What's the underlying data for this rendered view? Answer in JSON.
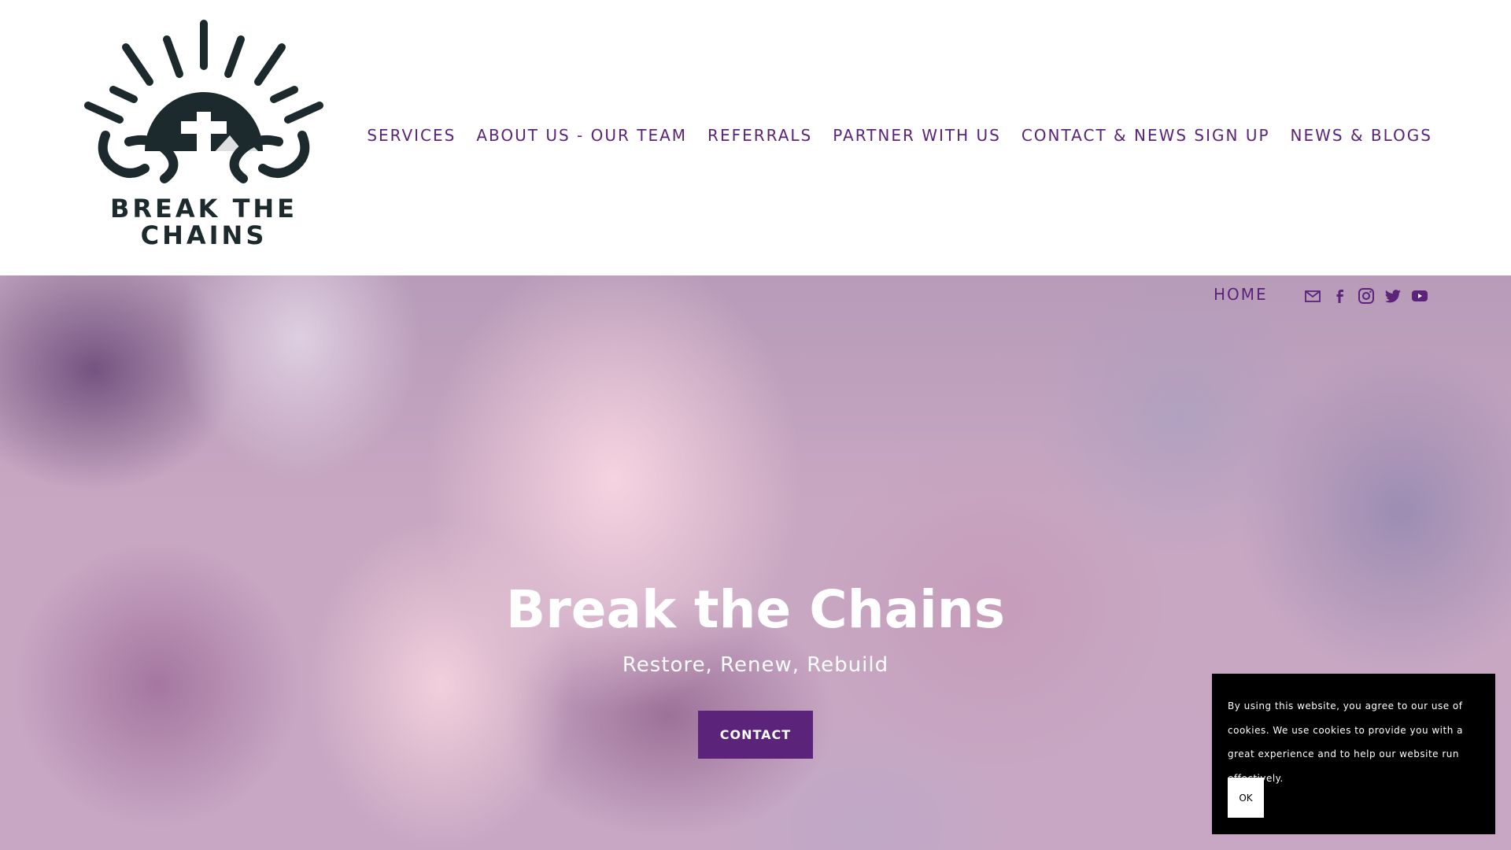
{
  "colors": {
    "brand_purple": "#5b237a",
    "logo_dark": "#1c2a2e",
    "cookie_bg": "#000000"
  },
  "logo": {
    "line1": "BREAK THE",
    "line2": "CHAINS"
  },
  "nav": {
    "items": [
      {
        "label": "SERVICES"
      },
      {
        "label": "ABOUT US - OUR TEAM"
      },
      {
        "label": "REFERRALS"
      },
      {
        "label": "PARTNER WITH US"
      },
      {
        "label": "CONTACT & NEWS SIGN UP"
      },
      {
        "label": "NEWS & BLOGS"
      }
    ],
    "home_label": "HOME"
  },
  "social": {
    "icons": [
      "email-icon",
      "facebook-icon",
      "instagram-icon",
      "twitter-icon",
      "youtube-icon"
    ]
  },
  "hero": {
    "title": "Break the Chains",
    "subtitle": "Restore, Renew, Rebuild",
    "button_label": "CONTACT"
  },
  "cookie": {
    "text": "By using this website, you agree to our use of cookies. We use cookies to provide you with a great experience and to help our website run effectively.",
    "ok_label": "OK"
  }
}
